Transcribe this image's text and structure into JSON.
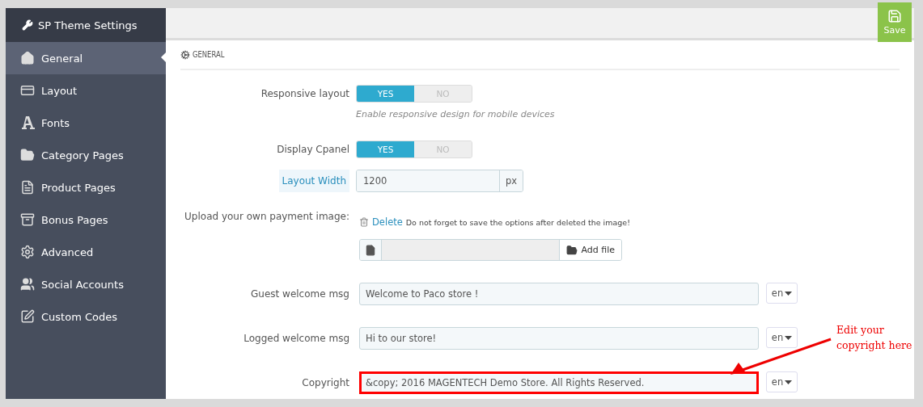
{
  "sidebar": {
    "title": "SP Theme Settings",
    "items": [
      {
        "label": "General",
        "selected": true
      },
      {
        "label": "Layout",
        "selected": false
      },
      {
        "label": "Fonts",
        "selected": false
      },
      {
        "label": "Category Pages",
        "selected": false
      },
      {
        "label": "Product Pages",
        "selected": false
      },
      {
        "label": "Bonus Pages",
        "selected": false
      },
      {
        "label": "Advanced",
        "selected": false
      },
      {
        "label": "Social Accounts",
        "selected": false
      },
      {
        "label": "Custom Codes",
        "selected": false
      }
    ]
  },
  "toolbar": {
    "save": "Save"
  },
  "section": {
    "title": "GENERAL"
  },
  "fields": [
    {
      "kind": "toggle",
      "label": "Responsive layout",
      "options": [
        {
          "label": "YES",
          "selected": true
        },
        {
          "label": "NO",
          "selected": false
        }
      ],
      "hint": "Enable responsive design for mobile devices"
    },
    {
      "kind": "toggle",
      "label": "Display Cpanel",
      "options": [
        {
          "label": "YES",
          "selected": true
        },
        {
          "label": "NO",
          "selected": false
        }
      ]
    },
    {
      "kind": "input_addon",
      "label": "Layout Width",
      "label_tooltip": true,
      "value": "1200",
      "addon": "px"
    },
    {
      "kind": "upload",
      "label": "Upload your own payment image:",
      "delete_link": "Delete",
      "delete_note": "Do not forget to save the options after deleted the image!",
      "button": "Add file"
    },
    {
      "kind": "text_lang",
      "label": "Guest welcome msg",
      "value": "Welcome to Paco store !",
      "language": "en",
      "highlighted": false
    },
    {
      "kind": "text_lang",
      "label": "Logged welcome msg",
      "value": "Hi to our store!",
      "language": "en",
      "highlighted": false
    },
    {
      "kind": "text_lang",
      "label": "Copyright",
      "value": "&copy; 2016 MAGENTECH Demo Store. All Rights Reserved.",
      "language": "en",
      "highlighted": true
    }
  ],
  "annotation": {
    "lines": [
      "Edit your",
      "copyright here"
    ]
  }
}
